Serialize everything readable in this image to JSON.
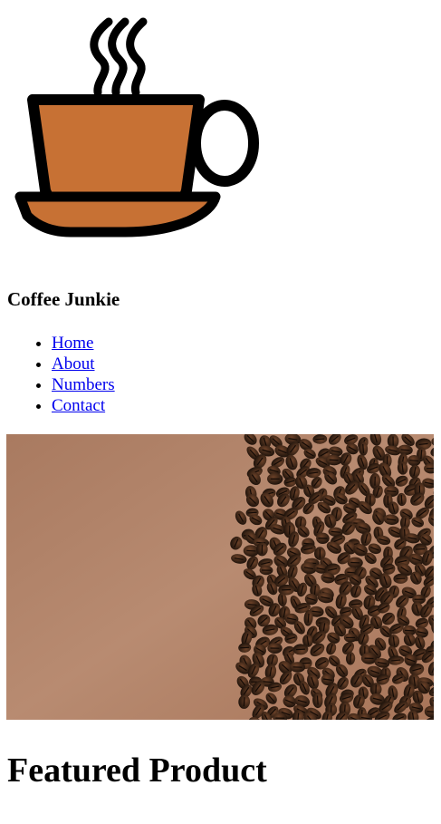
{
  "header": {
    "logo_icon": "coffee-cup-icon",
    "title": "Coffee Junkie"
  },
  "nav": {
    "items": [
      {
        "label": "Home"
      },
      {
        "label": "About"
      },
      {
        "label": "Numbers"
      },
      {
        "label": "Contact"
      }
    ]
  },
  "hero": {
    "image": "coffee-beans-image"
  },
  "main": {
    "heading": "Featured Product"
  },
  "colors": {
    "cup_fill": "#c77134",
    "outline": "#000000",
    "link": "#0000ee",
    "hero_background": "#b3846a",
    "bean": "#3a2416"
  }
}
